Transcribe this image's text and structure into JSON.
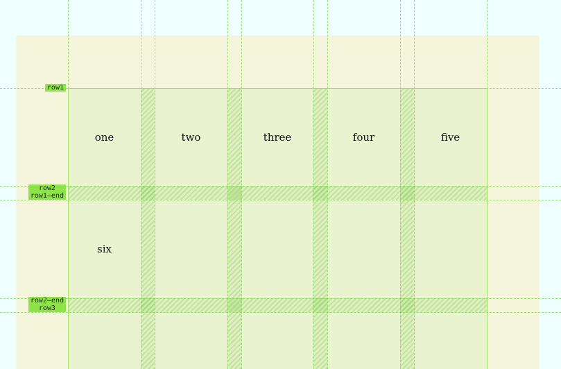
{
  "grid": {
    "cells": [
      {
        "id": "one",
        "text": "one"
      },
      {
        "id": "two",
        "text": "two"
      },
      {
        "id": "three",
        "text": "three"
      },
      {
        "id": "four",
        "text": "four"
      },
      {
        "id": "five",
        "text": "five"
      },
      {
        "id": "six",
        "text": "six"
      }
    ]
  },
  "line_labels": {
    "row1": "row1",
    "row2": "row2",
    "row1_end": "row1–end",
    "row2_end": "row2–end",
    "row3": "row3"
  },
  "colors": {
    "page_background": "#f0ffff",
    "container_background": "#f5f5dc",
    "grid_overlay": "#8ee24a"
  }
}
